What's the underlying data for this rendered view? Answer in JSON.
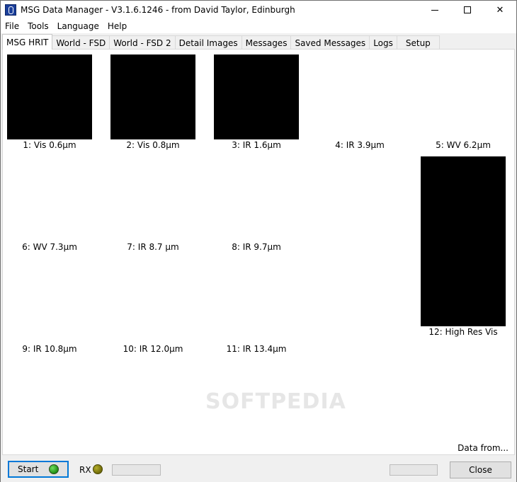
{
  "window": {
    "title": "MSG Data Manager - V3.1.6.1246 - from David Taylor, Edinburgh"
  },
  "menu": [
    "File",
    "Tools",
    "Language",
    "Help"
  ],
  "tabs": [
    "MSG HRIT",
    "World - FSD",
    "World - FSD 2",
    "Detail Images",
    "Messages",
    "Saved Messages",
    "Logs",
    "Setup"
  ],
  "channels": [
    {
      "label": "1:  Vis 0.6µm"
    },
    {
      "label": "2:  Vis 0.8µm"
    },
    {
      "label": "3:  IR 1.6µm"
    },
    {
      "label": "4:  IR 3.9µm"
    },
    {
      "label": "5:  WV 6.2µm"
    },
    {
      "label": "6:  WV 7.3µm"
    },
    {
      "label": "7:  IR 8.7 µm"
    },
    {
      "label": "8:  IR 9.7µm"
    },
    {
      "label": "9:  IR 10.8µm"
    },
    {
      "label": "10:  IR 12.0µm"
    },
    {
      "label": "11:  IR 13.4µm"
    },
    {
      "label": "12:  High Res Vis"
    }
  ],
  "watermark": "SOFTPEDIA",
  "data_from": "Data from...",
  "bottom": {
    "start_label": "Start",
    "rx_label": "RX",
    "close_label": "Close"
  }
}
